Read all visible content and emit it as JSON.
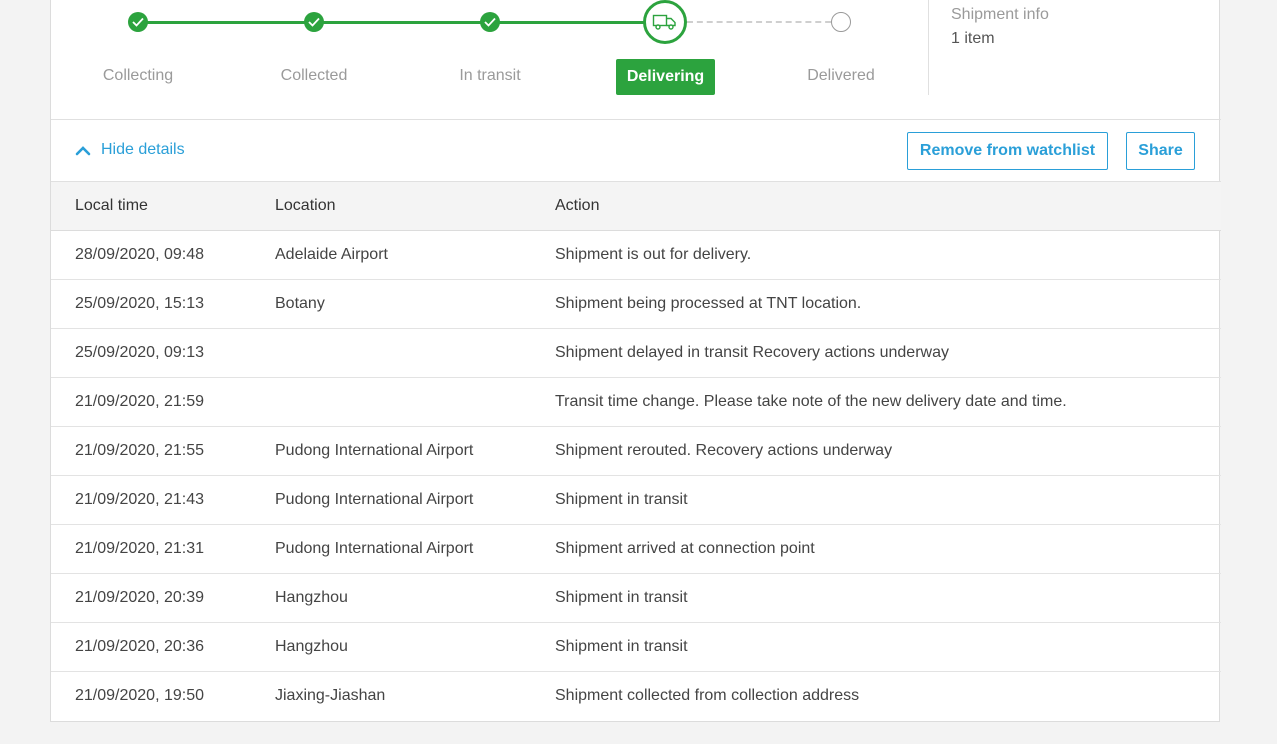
{
  "steps": [
    {
      "label": "Collecting",
      "state": "done"
    },
    {
      "label": "Collected",
      "state": "done"
    },
    {
      "label": "In transit",
      "state": "done"
    },
    {
      "label": "Delivering",
      "state": "current"
    },
    {
      "label": "Delivered",
      "state": "pending"
    }
  ],
  "shipment_info": {
    "title": "Shipment info",
    "value": "1 item"
  },
  "controls": {
    "hide_details": "Hide details",
    "remove_watchlist": "Remove from watchlist",
    "share": "Share"
  },
  "table": {
    "headers": [
      "Local time",
      "Location",
      "Action"
    ],
    "rows": [
      [
        "28/09/2020, 09:48",
        "Adelaide Airport",
        "Shipment is out for delivery."
      ],
      [
        "25/09/2020, 15:13",
        "Botany",
        "Shipment being processed at TNT location."
      ],
      [
        "25/09/2020, 09:13",
        "",
        "Shipment delayed in transit Recovery actions underway"
      ],
      [
        "21/09/2020, 21:59",
        "",
        "Transit time change. Please take note of the new delivery date and time."
      ],
      [
        "21/09/2020, 21:55",
        "Pudong International Airport",
        "Shipment rerouted. Recovery actions underway"
      ],
      [
        "21/09/2020, 21:43",
        "Pudong International Airport",
        "Shipment in transit"
      ],
      [
        "21/09/2020, 21:31",
        "Pudong International Airport",
        "Shipment arrived at connection point"
      ],
      [
        "21/09/2020, 20:39",
        "Hangzhou",
        "Shipment in transit"
      ],
      [
        "21/09/2020, 20:36",
        "Hangzhou",
        "Shipment in transit"
      ],
      [
        "21/09/2020, 19:50",
        "Jiaxing-Jiashan",
        "Shipment collected from collection address"
      ]
    ]
  },
  "colors": {
    "accent_green": "#2ca33e",
    "link_blue": "#2a9fd8"
  }
}
